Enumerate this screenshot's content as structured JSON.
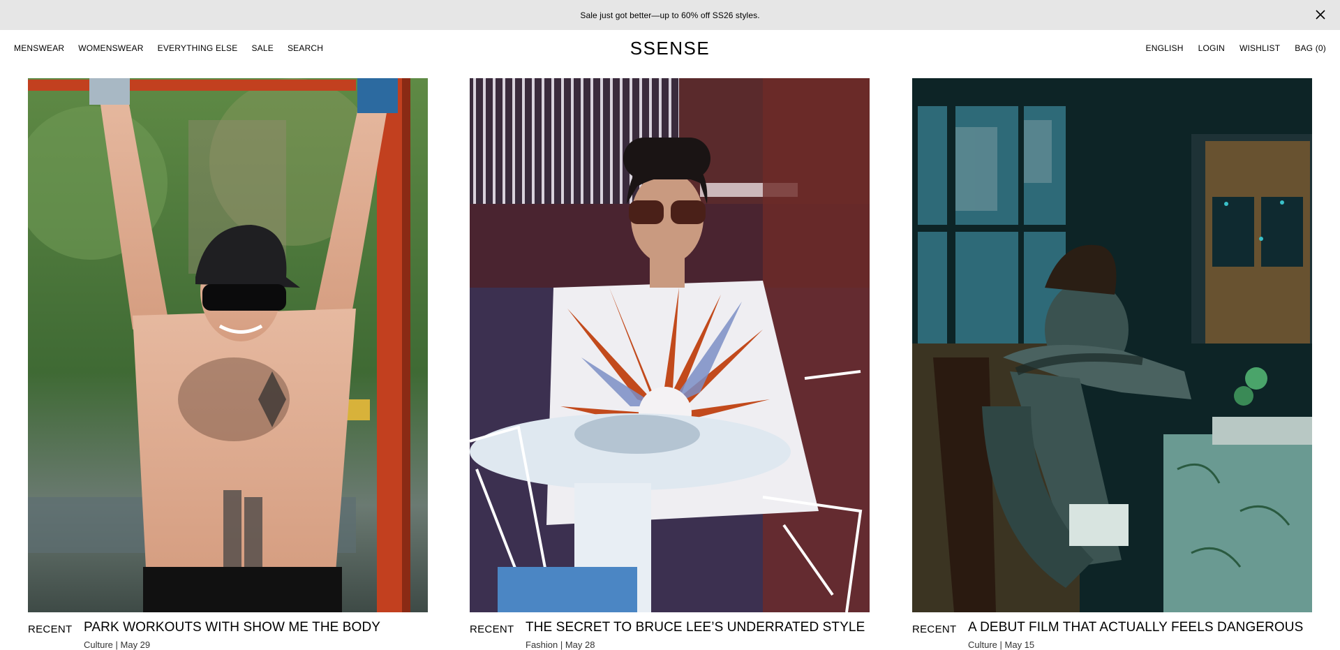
{
  "promo": {
    "text": "Sale just got better—up to 60% off SS26 styles.",
    "close_icon": "close-icon"
  },
  "nav": {
    "left": [
      "MENSWEAR",
      "WOMENSWEAR",
      "EVERYTHING ELSE",
      "SALE",
      "SEARCH"
    ],
    "logo": "SSENSE",
    "right": [
      "ENGLISH",
      "LOGIN",
      "WISHLIST",
      "BAG (0)"
    ]
  },
  "articles": [
    {
      "tag": "RECENT",
      "title": "PARK WORKOUTS WITH SHOW ME THE BODY",
      "subtitle": "Culture | May 29"
    },
    {
      "tag": "RECENT",
      "title": "THE SECRET TO BRUCE LEE’S UNDERRATED STYLE",
      "subtitle": "Fashion | May 28"
    },
    {
      "tag": "RECENT",
      "title": "A DEBUT FILM THAT ACTUALLY FEELS DANGEROUS",
      "subtitle": "Culture | May 15"
    }
  ],
  "colors": {
    "promo_bg": "#e6e6e6",
    "text": "#000000"
  }
}
